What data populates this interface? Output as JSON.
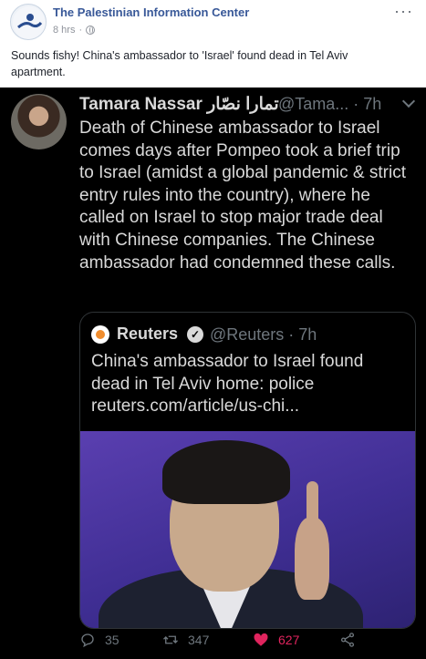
{
  "post": {
    "page_name": "The Palestinian Information Center",
    "time": "8 hrs",
    "time_separator": "·",
    "more_label": "···",
    "caption": "Sounds fishy! China's ambassador to 'Israel' found dead in Tel Aviv apartment."
  },
  "tweet": {
    "author_name": "Tamara Nassar تمارا نصّار",
    "handle_time": "@Tama... · 7h",
    "text": "Death of Chinese ambassador to Israel comes days after Pompeo took a brief trip to Israel (amidst a global pandemic & strict entry rules into the country), where he called on Israel to stop major trade deal with Chinese companies. The Chinese ambassador had condemned these calls.",
    "quote": {
      "author_name": "Reuters",
      "verified_mark": "✓",
      "handle_time": "@Reuters · 7h",
      "text": "China's ambassador to Israel found dead in Tel Aviv home: police reuters.com/article/us-chi..."
    },
    "actions": {
      "replies": "35",
      "retweets": "347",
      "likes": "627"
    }
  },
  "icons": {
    "reply": "reply-icon",
    "retweet": "retweet-icon",
    "like": "heart-icon",
    "share": "share-icon",
    "globe": "globe-icon",
    "caret": "chevron-down-icon"
  },
  "colors": {
    "facebook_link": "#385898",
    "tweet_background": "#000000",
    "tweet_text": "#d9d9d9",
    "tweet_secondary": "#6e767d",
    "like_active": "#e0245e"
  }
}
